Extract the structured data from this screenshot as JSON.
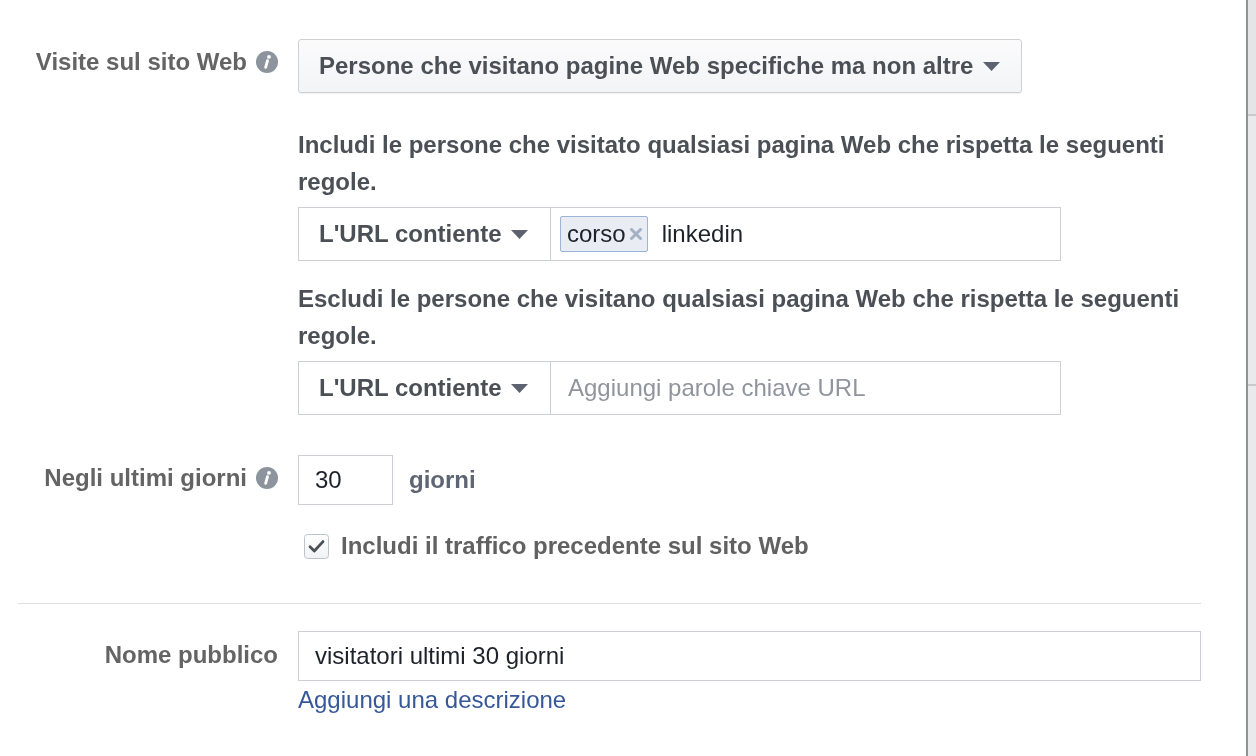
{
  "website_visits": {
    "label": "Visite sul sito Web",
    "info": true,
    "dropdown": "Persone che visitano pagine Web specifiche ma non altre"
  },
  "include_rule": {
    "heading": "Includi le persone che visitato qualsiasi pagina Web che rispetta le seguenti regole.",
    "operator": "L'URL contiente",
    "tokens": [
      "corso"
    ],
    "value": "linkedin"
  },
  "exclude_rule": {
    "heading": "Escludi le persone che visitano qualsiasi pagina Web che rispetta le seguenti regole.",
    "operator": "L'URL contiente",
    "placeholder": "Aggiungi parole chiave URL"
  },
  "time_window": {
    "label": "Negli ultimi giorni",
    "info": true,
    "value": "30",
    "unit": "giorni"
  },
  "include_past_traffic": {
    "label": "Includi il traffico precedente sul sito Web",
    "checked": true
  },
  "audience_name": {
    "label": "Nome pubblico",
    "value": "visitatori ultimi 30 giorni",
    "link": "Aggiungi una descrizione"
  }
}
